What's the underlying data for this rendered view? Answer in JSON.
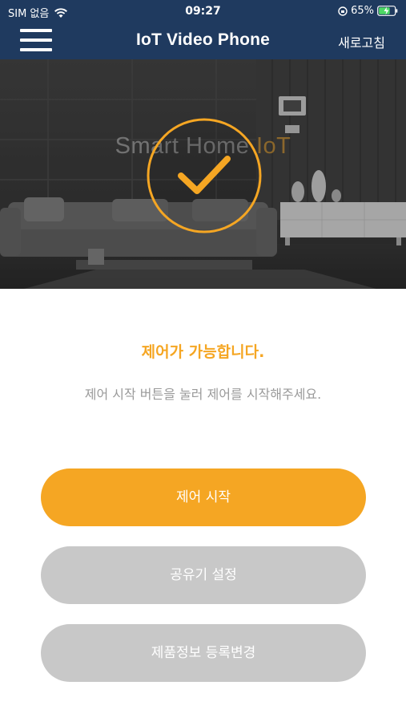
{
  "status_bar": {
    "carrier": "SIM 없음",
    "time": "09:27",
    "battery": "65%"
  },
  "nav": {
    "title": "IoT Video Phone",
    "refresh_label": "새로고침"
  },
  "hero": {
    "watermark_text": "Smart Home ",
    "watermark_accent": "IoT"
  },
  "content": {
    "heading": "제어가 가능합니다.",
    "subtext": "제어 시작 버튼을 눌러 제어를 시작해주세요."
  },
  "buttons": {
    "start_control": "제어 시작",
    "router_settings": "공유기 설정",
    "product_info": "제품정보 등록변경"
  },
  "colors": {
    "header_bg": "#1f3a5f",
    "accent": "#f5a623",
    "secondary_button": "#c8c8c8",
    "subtext": "#9a9a9a"
  },
  "icons": {
    "menu": "hamburger-menu-icon",
    "status": "check-circle-icon",
    "wifi": "wifi-icon",
    "battery": "battery-charging-icon"
  }
}
